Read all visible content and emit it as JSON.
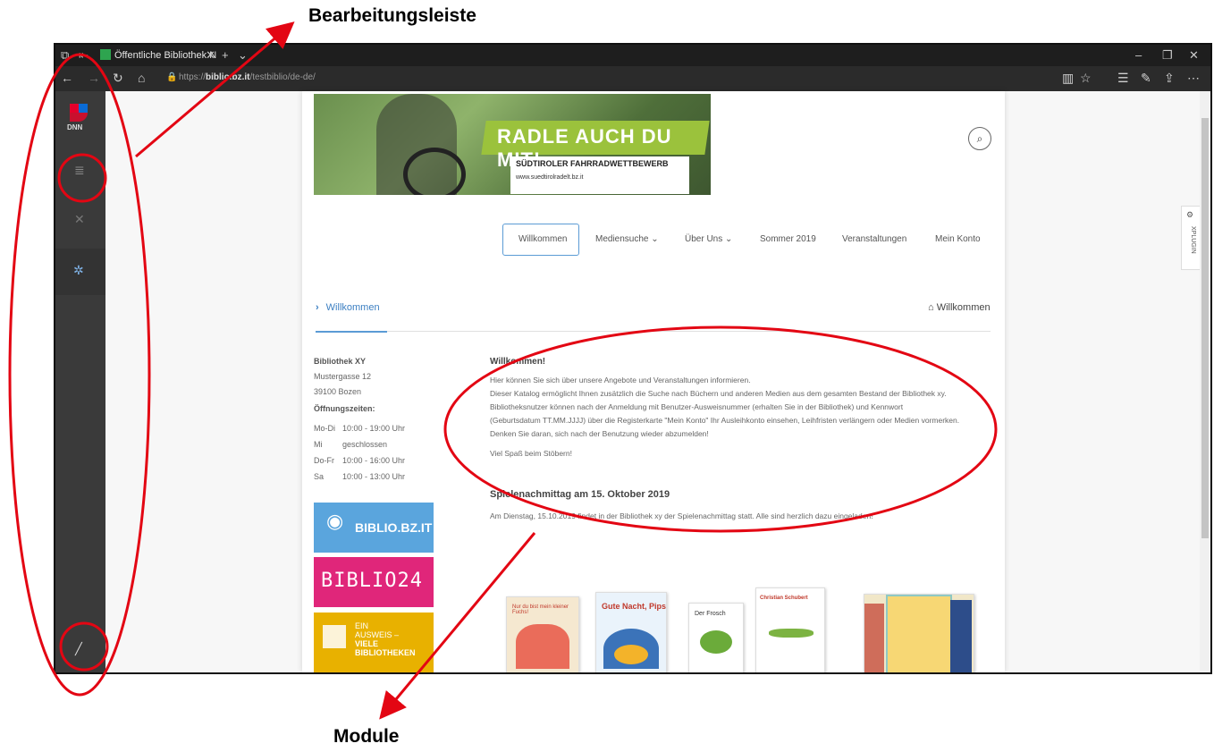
{
  "annotations": {
    "top_label": "Bearbeitungsleiste",
    "bottom_label": "Module"
  },
  "browser": {
    "tab_title": "Öffentliche Bibliothek N",
    "url_prefix": "https://",
    "url_domain": "biblio.bz.it",
    "url_path": "/testbiblio/de-de/"
  },
  "banner": {
    "headline": "RADLE AUCH DU MIT!",
    "subline": "SÜDTIROLER FAHRRADWETTBEWERB",
    "url": "www.suedtirolradelt.bz.it"
  },
  "menu": [
    {
      "label": "Willkommen"
    },
    {
      "label": "Mediensuche"
    },
    {
      "label": "Über Uns"
    },
    {
      "label": "Sommer 2019"
    },
    {
      "label": "Veranstaltungen"
    },
    {
      "label": "Mein Konto"
    }
  ],
  "breadcrumb": {
    "label": "Willkommen",
    "home_label": "Willkommen"
  },
  "library": {
    "name": "Bibliothek XY",
    "street": "Mustergasse 12",
    "city": "39100 Bozen",
    "hours_title": "Öffnungszeiten:",
    "hours": [
      {
        "day": "Mo-Di",
        "time": "10:00 - 19:00 Uhr"
      },
      {
        "day": "Mi",
        "time": "geschlossen"
      },
      {
        "day": "Do-Fr",
        "time": "10:00 - 16:00 Uhr"
      },
      {
        "day": "Sa",
        "time": "10:00 - 13:00 Uhr"
      }
    ]
  },
  "tiles": {
    "biblio": "BIBLIO.BZ.IT",
    "biblio24": "BIBLIO24",
    "ausweis_1": "EIN",
    "ausweis_2": "AUSWEIS –",
    "ausweis_3": "VIELE",
    "ausweis_4": "BIBLIOTHEKEN"
  },
  "content": {
    "welcome_title": "Willkommen!",
    "lines": [
      "Hier können Sie sich über unsere Angebote und Veranstaltungen informieren.",
      "Dieser Katalog ermöglicht Ihnen zusätzlich die Suche nach Büchern und anderen Medien aus dem gesamten Bestand der Bibliothek xy.",
      "Bibliotheksnutzer können nach der Anmeldung mit Benutzer-Ausweisnummer (erhalten Sie in der Bibliothek) und Kennwort",
      "(Geburtsdatum TT.MM.JJJJ) über die Registerkarte \"Mein Konto\" Ihr Ausleihkonto einsehen, Leihfristen verlängern oder Medien vormerken.",
      "Denken Sie daran, sich nach der Benutzung wieder abzumelden!"
    ],
    "fun": "Viel Spaß beim Stöbern!",
    "event_title": "Spielenachmittag am 15. Oktober 2019",
    "event_text": "Am Dienstag, 15.10.2019 findet in der Bibliothek xy der Spielenachmittag statt. Alle sind herzlich dazu eingeladen!"
  },
  "books": [
    {
      "title": "Nur du bist mein kleiner Fuchs!"
    },
    {
      "title": "Gute Nacht, Pips"
    },
    {
      "title": "Der Frosch"
    },
    {
      "title": "Christian Schubert"
    },
    {
      "title": ""
    }
  ],
  "xplugin": "XPLUGIN",
  "persona": {
    "logo": "DNN"
  },
  "colors": {
    "annotation": "#e30613",
    "link": "#3c7fc2",
    "persona_bar": "#3a3a3a"
  }
}
